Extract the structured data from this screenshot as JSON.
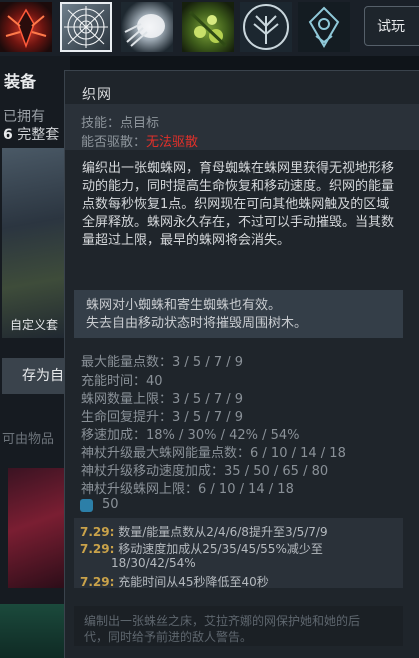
{
  "top_bar": {
    "abilities": [
      {
        "icon": "spider-queen-icon"
      },
      {
        "icon": "spider-web-icon"
      },
      {
        "icon": "white-wisp-icon"
      },
      {
        "icon": "green-eggs-icon"
      },
      {
        "icon": "tree-icon"
      },
      {
        "icon": "talent-tree-icon"
      }
    ],
    "tryout_label": "试玩"
  },
  "left_panel": {
    "equipment_label": "装备",
    "owned_label": "已拥有",
    "complete_count": "6",
    "complete_label": "完整套",
    "custom_label": "自定义套",
    "save_label": "存为自",
    "from_label": "可由物品"
  },
  "tooltip": {
    "title": "织网",
    "ability_label": "技能：",
    "ability_value": "点目标",
    "dispel_label": "能否驱散：",
    "dispel_value": "无法驱散",
    "description": "编织出一张蜘蛛网，育母蜘蛛在蛛网里获得无视地形移动的能力，同时提高生命恢复和移动速度。织网的能量点数每秒恢复1点。织网现在可向其他蛛网触及的区域全屏释放。蛛网永久存在，不过可以手动摧毁。当其数量超过上限，最早的蛛网将会消失。",
    "notes": [
      "蛛网对小蜘蛛和寄生蜘蛛也有效。",
      "失去自由移动状态时将摧毁周围树木。"
    ],
    "stats": [
      {
        "label": "最大能量点数：",
        "value": "3 / 5 / 7 / 9"
      },
      {
        "label": "充能时间：",
        "value": "40"
      },
      {
        "label": "蛛网数量上限：",
        "value": "3 / 5 / 7 / 9"
      },
      {
        "label": "生命回复提升：",
        "value": "3 / 5 / 7 / 9"
      },
      {
        "label": "移速加成：",
        "value": "18% / 30% / 42% / 54%"
      },
      {
        "label": "神杖升级最大蛛网能量点数：",
        "value": "6 / 10 / 14 / 18"
      },
      {
        "label": "神杖升级移动速度加成：",
        "value": "35 / 50 / 65 / 80"
      },
      {
        "label": "神杖升级蛛网上限：",
        "value": "6 / 10 / 14 / 18"
      }
    ],
    "mana_cost": "50",
    "patch_notes": [
      {
        "version": "7.29:",
        "text": "数量/能量点数从2/4/6/8提升至3/5/7/9"
      },
      {
        "version": "7.29:",
        "text": "移动速度加成从25/35/45/55%减少至"
      },
      {
        "version": "",
        "text": "18/30/42/54%"
      },
      {
        "version": "7.29:",
        "text": "充能时间从45秒降低至40秒"
      }
    ],
    "lore": [
      "编制出一张蛛丝之床，艾拉齐娜的网保护她和她的后",
      "代，同时给予前进的敌人警告。"
    ]
  },
  "colors": {
    "background": "#0f1419",
    "tooltip_bg": "#1f252b",
    "dispel_red": "#e0302a",
    "patch_gold": "#c9a24a",
    "mana_blue": "#2c7fa8"
  }
}
